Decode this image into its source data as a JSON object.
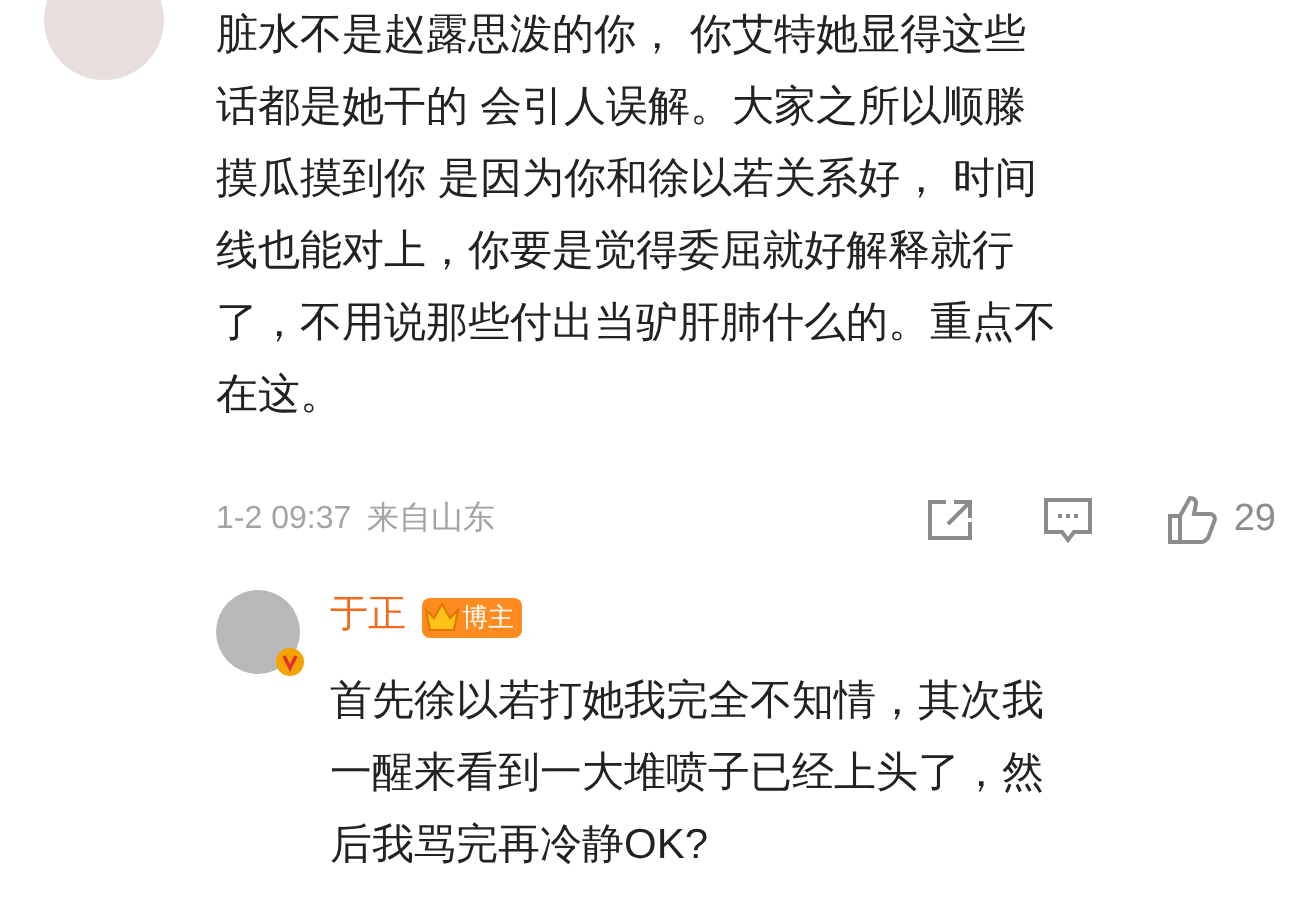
{
  "comment": {
    "text_lines": [
      "脏水不是赵露思泼的你， 你艾特她显得这些",
      "话都是她干的 会引人误解。大家之所以顺滕",
      "摸瓜摸到你 是因为你和徐以若关系好， 时间",
      "线也能对上，你要是觉得委屈就好解释就行",
      "了，不用说那些付出当驴肝肺什么的。重点不",
      "在这。"
    ],
    "time": "1-2 09:37",
    "location": "来自山东",
    "likes": "29"
  },
  "reply": {
    "author": "于正",
    "badge": "博主",
    "verified": true,
    "text_lines": [
      "首先徐以若打她我完全不知情，其次我",
      "一醒来看到一大堆喷子已经上头了，然",
      "后我骂完再冷静OK?"
    ]
  }
}
